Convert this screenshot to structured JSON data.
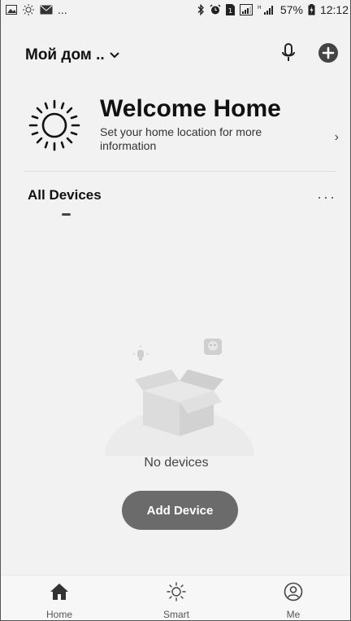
{
  "status_bar": {
    "left_text": "...",
    "battery": "57%",
    "time": "12:12",
    "icons_left": [
      "image-icon",
      "sun-icon",
      "mail-icon"
    ],
    "icons_right": [
      "bluetooth-icon",
      "alarm-icon",
      "sim-icon",
      "signal-icon",
      "signal-icon"
    ]
  },
  "header": {
    "home_name": "Мой дом ..",
    "mic_icon": "microphone-icon",
    "add_icon": "add-icon"
  },
  "welcome": {
    "title": "Welcome Home",
    "subtitle": "Set your home location for more information",
    "chevron": "›"
  },
  "devices": {
    "title": "All Devices",
    "more": "···"
  },
  "empty_state": {
    "text": "No devices",
    "button": "Add Device"
  },
  "nav": {
    "items": [
      {
        "label": "Home",
        "icon": "home-icon"
      },
      {
        "label": "Smart",
        "icon": "sun-icon"
      },
      {
        "label": "Me",
        "icon": "profile-icon"
      }
    ]
  },
  "colors": {
    "background": "#f2f2f2",
    "button": "#6b6b6b",
    "text": "#111111"
  }
}
